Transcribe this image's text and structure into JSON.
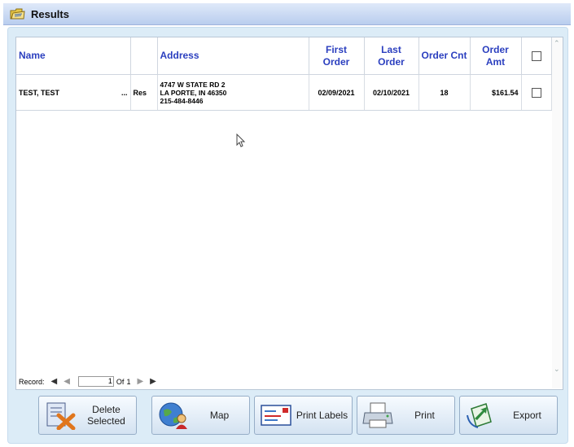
{
  "window": {
    "title": "Results",
    "title_icon": "folder-notes-icon"
  },
  "table": {
    "columns": [
      "Name",
      "",
      "Address",
      "First Order",
      "Last Order",
      "Order Cnt",
      "Order Amt"
    ],
    "rows": [
      {
        "name": "TEST, TEST",
        "more": "...",
        "type": "Res",
        "address_line1": "4747 W STATE RD 2",
        "address_line2": "LA PORTE, IN 46350",
        "phone": "215-484-8446",
        "first_order": "02/09/2021",
        "last_order": "02/10/2021",
        "order_cnt": "18",
        "order_amt": "$161.54"
      }
    ]
  },
  "pager": {
    "label": "Record:",
    "current": "1",
    "of_label": "Of",
    "total": "1"
  },
  "buttons": {
    "delete": "Delete Selected",
    "map": "Map",
    "print_labels": "Print Labels",
    "print": "Print",
    "export": "Export"
  },
  "colors": {
    "header_text": "#2b3fbf",
    "panel_bg": "#dcecf7",
    "titlebar": "#c8d9f3"
  }
}
